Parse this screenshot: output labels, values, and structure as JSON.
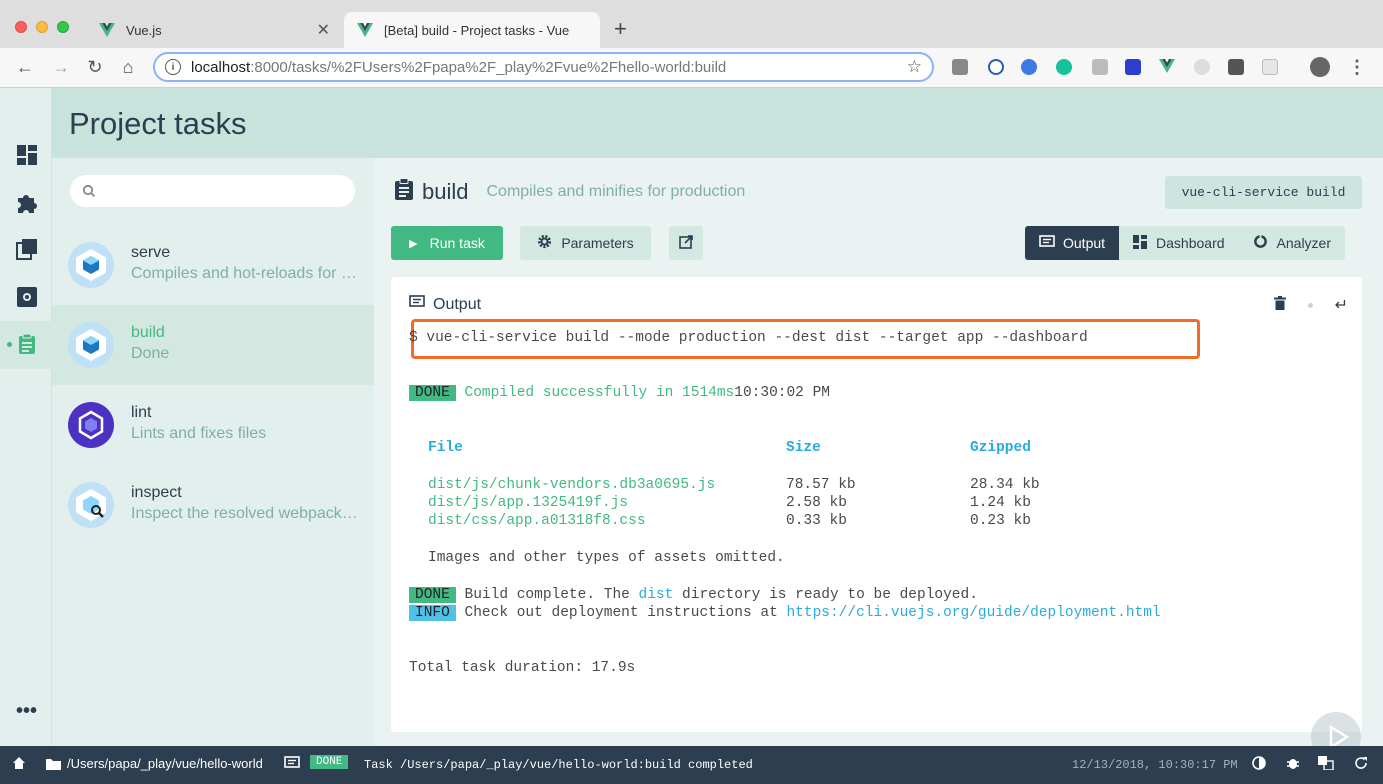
{
  "browser": {
    "tabs": [
      {
        "title": "Vue.js",
        "active": false
      },
      {
        "title": "[Beta] build - Project tasks - Vue",
        "active": true
      }
    ],
    "address": {
      "host": "localhost",
      "rest": ":8000/tasks/%2FUsers%2Fpapa%2F_play%2Fvue%2Fhello-world:build"
    }
  },
  "header": {
    "title": "Project tasks"
  },
  "search": {
    "placeholder": ""
  },
  "tasks": [
    {
      "name": "serve",
      "desc": "Compiles and hot-reloads for development"
    },
    {
      "name": "build",
      "desc": "Done"
    },
    {
      "name": "lint",
      "desc": "Lints and fixes files"
    },
    {
      "name": "inspect",
      "desc": "Inspect the resolved webpack config"
    }
  ],
  "task_detail": {
    "name": "build",
    "description": "Compiles and minifies for production",
    "command": "vue-cli-service build"
  },
  "buttons": {
    "run": "Run task",
    "parameters": "Parameters",
    "output": "Output",
    "dashboard": "Dashboard",
    "analyzer": "Analyzer"
  },
  "output": {
    "title": "Output",
    "command_line": "$ vue-cli-service build --mode production --dest dist --target app --dashboard",
    "compiled": {
      "badge": "DONE",
      "text": "Compiled successfully in 1514ms",
      "time": "10:30:02 PM"
    },
    "table_headers": {
      "file": "File",
      "size": "Size",
      "gzipped": "Gzipped"
    },
    "files": [
      {
        "file": "dist/js/chunk-vendors.db3a0695.js",
        "size": "78.57 kb",
        "gzip": "28.34 kb"
      },
      {
        "file": "dist/js/app.1325419f.js",
        "size": "2.58 kb",
        "gzip": "1.24 kb"
      },
      {
        "file": "dist/css/app.a01318f8.css",
        "size": "0.33 kb",
        "gzip": "0.23 kb"
      }
    ],
    "omitted": "Images and other types of assets omitted.",
    "build_done": {
      "badge": "DONE",
      "pre": "Build complete. The ",
      "dist": "dist",
      "post": " directory is ready to be deployed."
    },
    "info": {
      "badge": "INFO",
      "pre": "Check out deployment instructions at ",
      "url": "https://cli.vuejs.org/guide/deployment.html"
    },
    "duration": "Total task duration: 17.9s"
  },
  "statusbar": {
    "path": "/Users/papa/_play/vue/hello-world",
    "badge": "DONE",
    "message": "Task /Users/papa/_play/vue/hello-world:build completed",
    "timestamp": "12/13/2018, 10:30:17 PM"
  },
  "colors": {
    "accent": "#42b983",
    "dark": "#2c3e50",
    "highlight": "#f26b2a",
    "info": "#4fc1e9"
  }
}
